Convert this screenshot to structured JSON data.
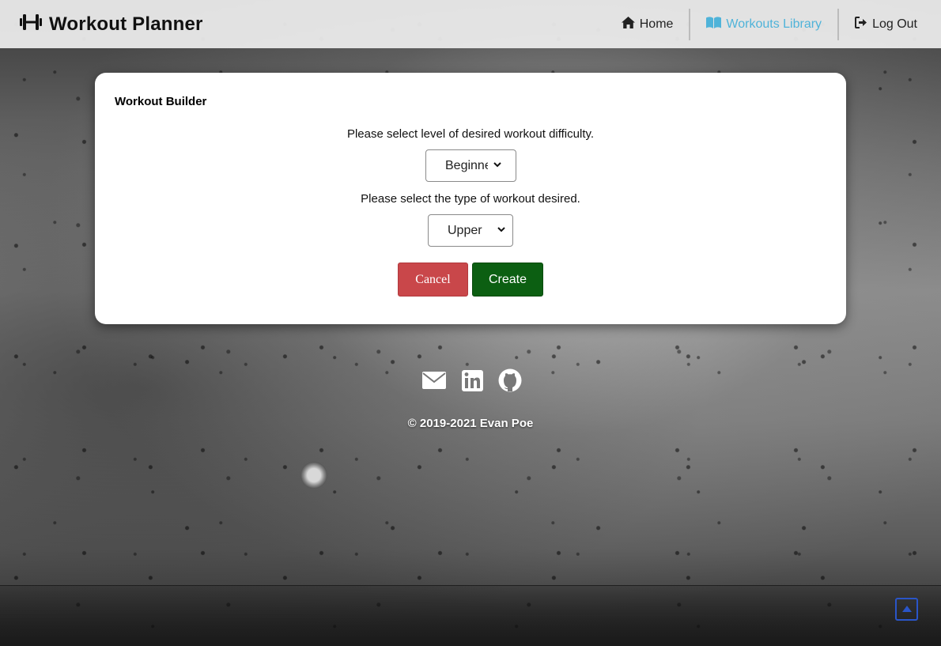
{
  "navbar": {
    "brand_title": "Workout Planner",
    "brand_icon": "dumbbell-icon",
    "links": [
      {
        "label": "Home",
        "icon": "home-icon",
        "active": false
      },
      {
        "label": "Workouts Library",
        "icon": "book-icon",
        "active": true
      },
      {
        "label": "Log Out",
        "icon": "logout-icon",
        "active": false
      }
    ]
  },
  "builder": {
    "title": "Workout Builder",
    "difficulty_prompt": "Please select level of desired workout difficulty.",
    "difficulty_value": "Beginner",
    "type_prompt": "Please select the type of workout desired.",
    "type_value": "Upper",
    "cancel_label": "Cancel",
    "create_label": "Create"
  },
  "footer": {
    "socials": [
      "envelope-icon",
      "linkedin-icon",
      "github-icon"
    ],
    "copyright": "© 2019-2021 Evan Poe"
  },
  "colors": {
    "active_link": "#4fb3d9",
    "cancel": "#c9474a",
    "create": "#0c5f12",
    "scroll_top": "#2a55c8"
  }
}
